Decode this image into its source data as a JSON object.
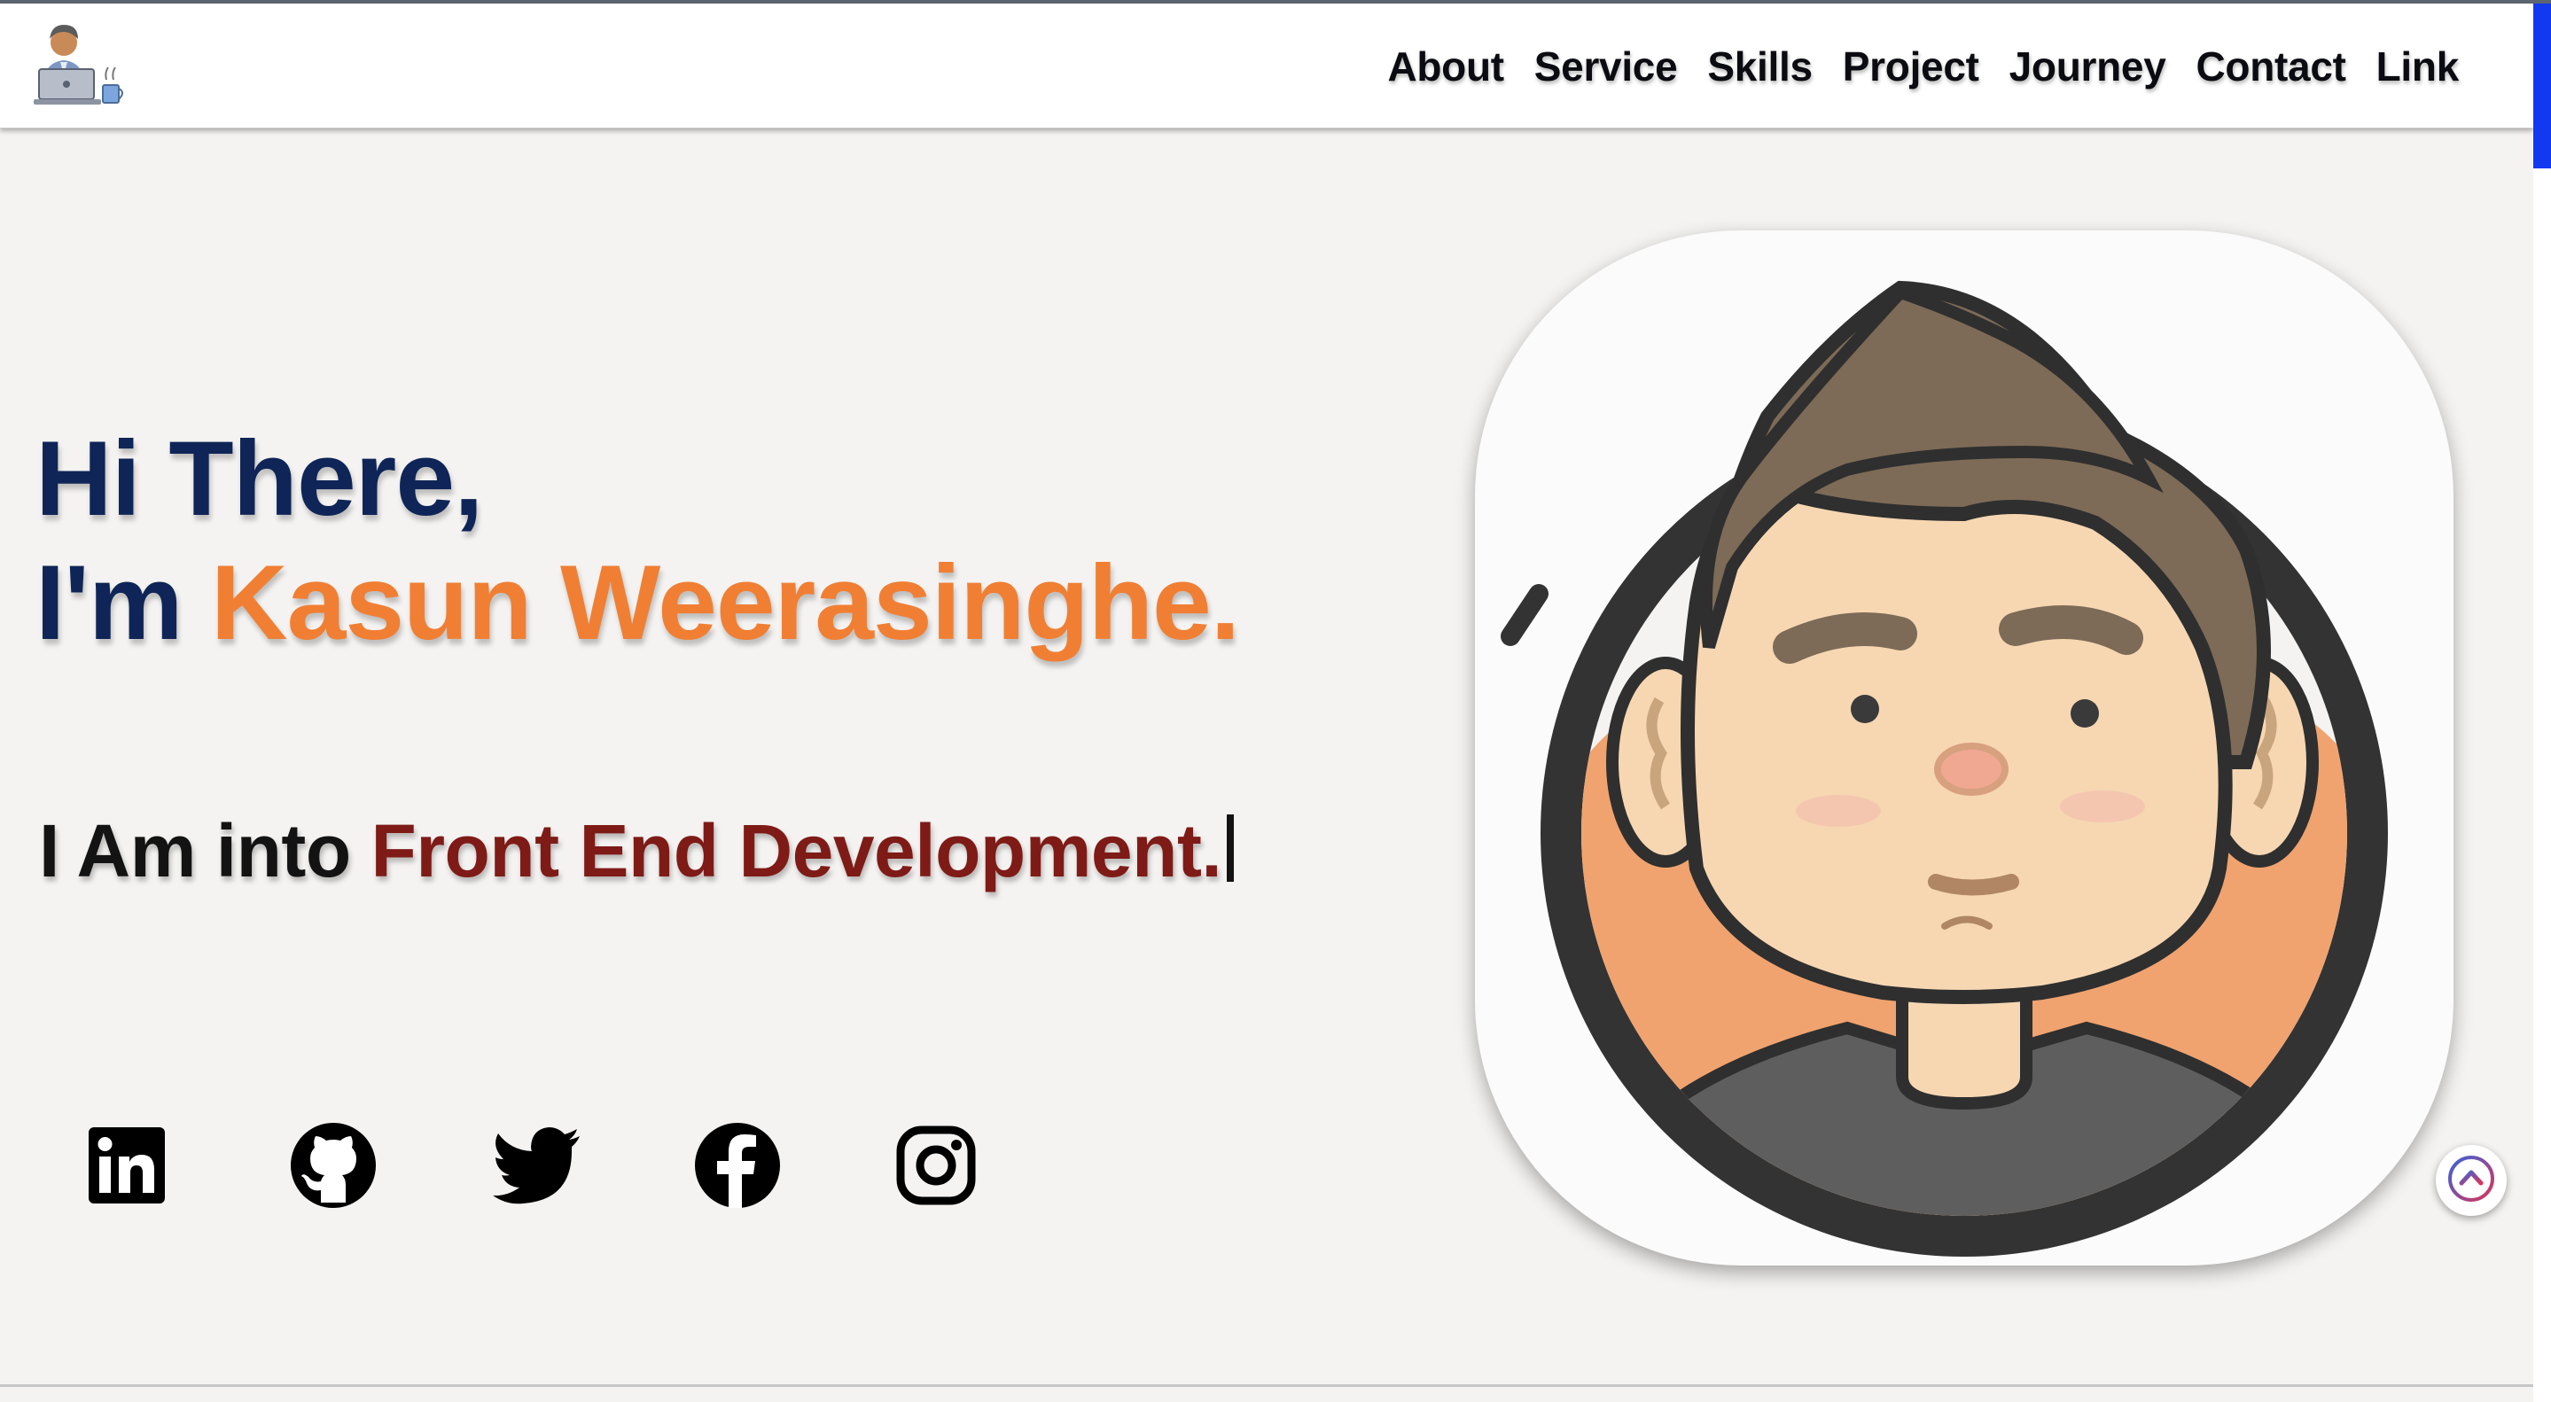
{
  "nav": {
    "links": [
      "About",
      "Service",
      "Skills",
      "Project",
      "Journey",
      "Contact",
      "Link"
    ]
  },
  "hero": {
    "greeting": "Hi There,",
    "intro_prefix": "I'm ",
    "name": "Kasun Weerasinghe.",
    "typing_prefix": "I Am into ",
    "typing_text": "Front End Development."
  },
  "social_icons": [
    "linkedin-icon",
    "github-icon",
    "twitter-icon",
    "facebook-icon",
    "instagram-icon"
  ],
  "icons": {
    "logo": "developer-at-laptop-logo",
    "scroll_top": "chevron-up-circle-icon"
  },
  "colors": {
    "navy": "#0f2557",
    "orange": "#f07f34",
    "dark_red": "#7e1b17",
    "scroll_indicator": "#1238f0"
  }
}
